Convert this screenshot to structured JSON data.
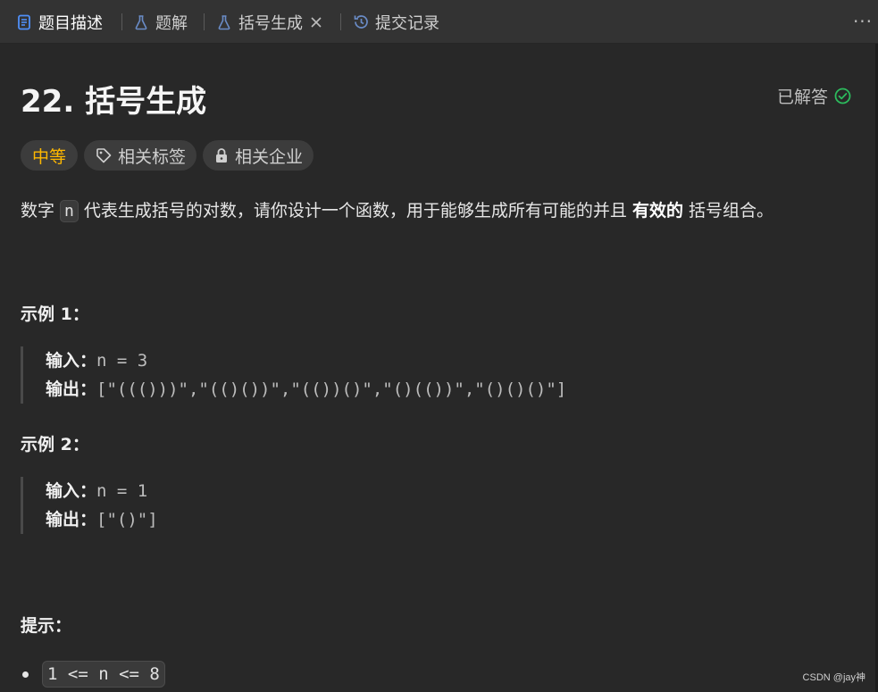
{
  "tabs": [
    {
      "label": "题目描述",
      "icon": "description-icon",
      "active": true
    },
    {
      "label": "题解",
      "icon": "flask-icon",
      "active": false
    },
    {
      "label": "括号生成",
      "icon": "flask-icon",
      "active": false,
      "closable": true
    },
    {
      "label": "提交记录",
      "icon": "history-icon",
      "active": false
    }
  ],
  "more_label": "···",
  "problem": {
    "title": "22. 括号生成",
    "status": "已解答",
    "difficulty": "中等",
    "tags_label": "相关标签",
    "companies_label": "相关企业"
  },
  "description": {
    "before": "数字 ",
    "var": "n",
    "middle": " 代表生成括号的对数，请你设计一个函数，用于能够生成所有可能的并且 ",
    "bold": "有效的",
    "after": " 括号组合。"
  },
  "examples": [
    {
      "heading": "示例 1：",
      "input_label": "输入：",
      "input": "n = 3",
      "output_label": "输出：",
      "output": "[\"((()))\",\"(()())\",\"(())()\",\"()(())\",\"()()()\"]"
    },
    {
      "heading": "示例 2：",
      "input_label": "输入：",
      "input": "n = 1",
      "output_label": "输出：",
      "output": "[\"()\"]"
    }
  ],
  "hints": {
    "heading": "提示：",
    "items": [
      "1 <= n <= 8"
    ]
  },
  "watermark": "CSDN @jay神",
  "colors": {
    "difficulty": "#ffb800",
    "solved_check": "#2cbb5d",
    "active_tab_icon": "#4f8ff7",
    "tab_icon": "#6a8cc7"
  }
}
